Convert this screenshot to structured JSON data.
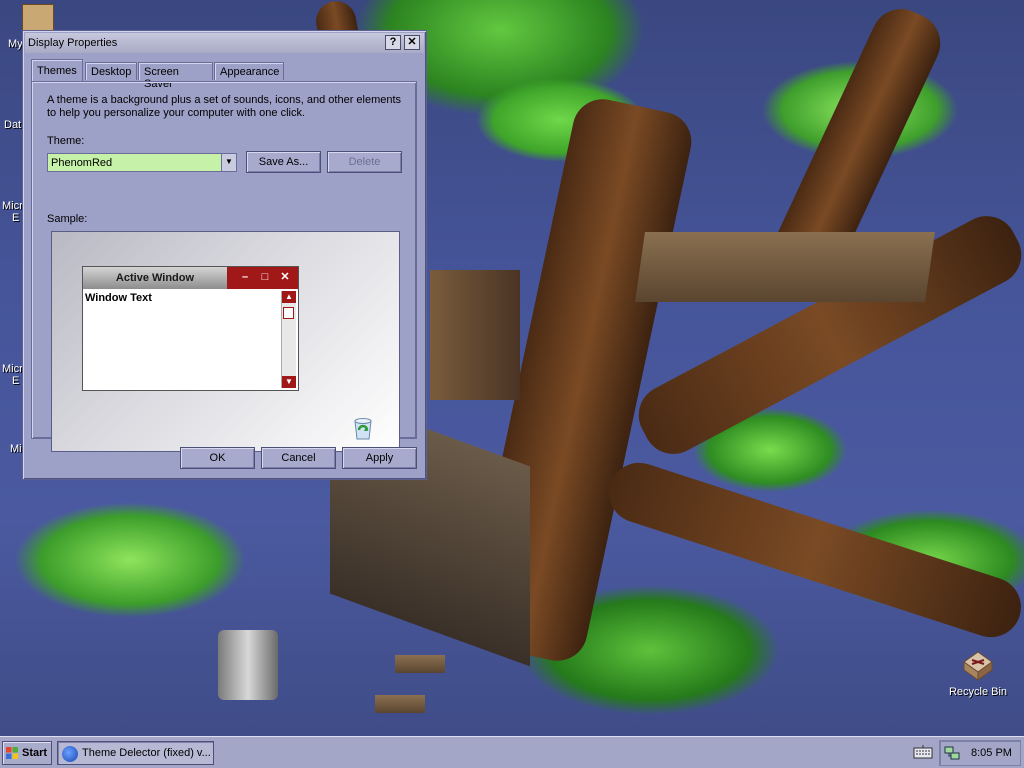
{
  "desktop": {
    "edge_labels": [
      "My",
      "Dat",
      "Micr",
      "E",
      "Micr",
      "E",
      "Mi"
    ],
    "recycle_bin": {
      "label": "Recycle Bin",
      "icon": "recycle-bin-icon"
    }
  },
  "window": {
    "title": "Display Properties",
    "help_btn": "?",
    "close_btn": "✕",
    "tabs": [
      {
        "label": "Themes",
        "active": true
      },
      {
        "label": "Desktop",
        "active": false
      },
      {
        "label": "Screen Saver",
        "active": false
      },
      {
        "label": "Appearance",
        "active": false
      }
    ],
    "description": "A theme is a background plus a set of sounds, icons, and other elements to help you personalize your computer with one click.",
    "theme_label": "Theme:",
    "theme_value": "PhenomRed",
    "save_as_label": "Save As...",
    "delete_label": "Delete",
    "sample_label": "Sample:",
    "sample": {
      "active_window_title": "Active Window",
      "window_text": "Window Text",
      "min_glyph": "–",
      "max_glyph": "□",
      "close_glyph": "✕"
    },
    "ok_label": "OK",
    "cancel_label": "Cancel",
    "apply_label": "Apply"
  },
  "taskbar": {
    "start_label": "Start",
    "task_label": "Theme Delector (fixed) v...",
    "clock": "8:05 PM"
  },
  "colors": {
    "window_face": "#9da0c7",
    "theme_select_bg": "#c5f2a8",
    "sample_accent": "#a11818"
  }
}
